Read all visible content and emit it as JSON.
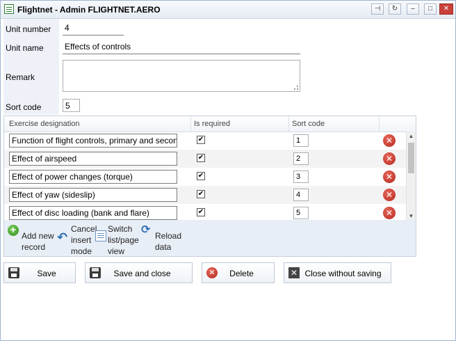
{
  "window": {
    "title": "Flightnet - Admin FLIGHTNET.AERO",
    "controls": {
      "pin": "⊣",
      "refresh": "↻",
      "minimize": "–",
      "maximize": "□",
      "close": "✕"
    }
  },
  "form": {
    "unit_number_label": "Unit number",
    "unit_number_value": "4",
    "unit_name_label": "Unit name",
    "unit_name_value": "Effects of controls",
    "remark_label": "Remark",
    "remark_value": "",
    "sort_code_label": "Sort code",
    "sort_code_value": "5"
  },
  "grid": {
    "columns": [
      "Exercise designation",
      "Is required",
      "Sort code"
    ],
    "rows": [
      {
        "designation": "Function of flight controls, primary and secondary",
        "required": true,
        "sort": "1"
      },
      {
        "designation": "Effect of airspeed",
        "required": true,
        "sort": "2"
      },
      {
        "designation": "Effect of power changes (torque)",
        "required": true,
        "sort": "3"
      },
      {
        "designation": "Effect of yaw (sideslip)",
        "required": true,
        "sort": "4"
      },
      {
        "designation": "Effect of disc loading (bank and flare)",
        "required": true,
        "sort": "5"
      }
    ],
    "check_glyph": "✔",
    "delete_glyph": "✕"
  },
  "toolbar": {
    "add_new_record": "Add new record",
    "cancel_insert_mode": "Cancel insert mode",
    "switch_view": "Switch list/page view",
    "reload_data": "Reload data"
  },
  "buttons": {
    "save": "Save",
    "save_and_close": "Save and close",
    "delete": "Delete",
    "close_without_saving": "Close without saving"
  },
  "colors": {
    "accent": "#2a6db5",
    "delete_red": "#c9413a",
    "add_green": "#2f8b1c"
  },
  "icons": [
    "app-icon",
    "pin-icon",
    "refresh-icon",
    "minimize-icon",
    "maximize-icon",
    "close-icon",
    "delete-row-icon",
    "add-icon",
    "undo-icon",
    "switch-view-icon",
    "reload-icon",
    "disk-icon",
    "delete-icon",
    "close-without-saving-icon"
  ]
}
